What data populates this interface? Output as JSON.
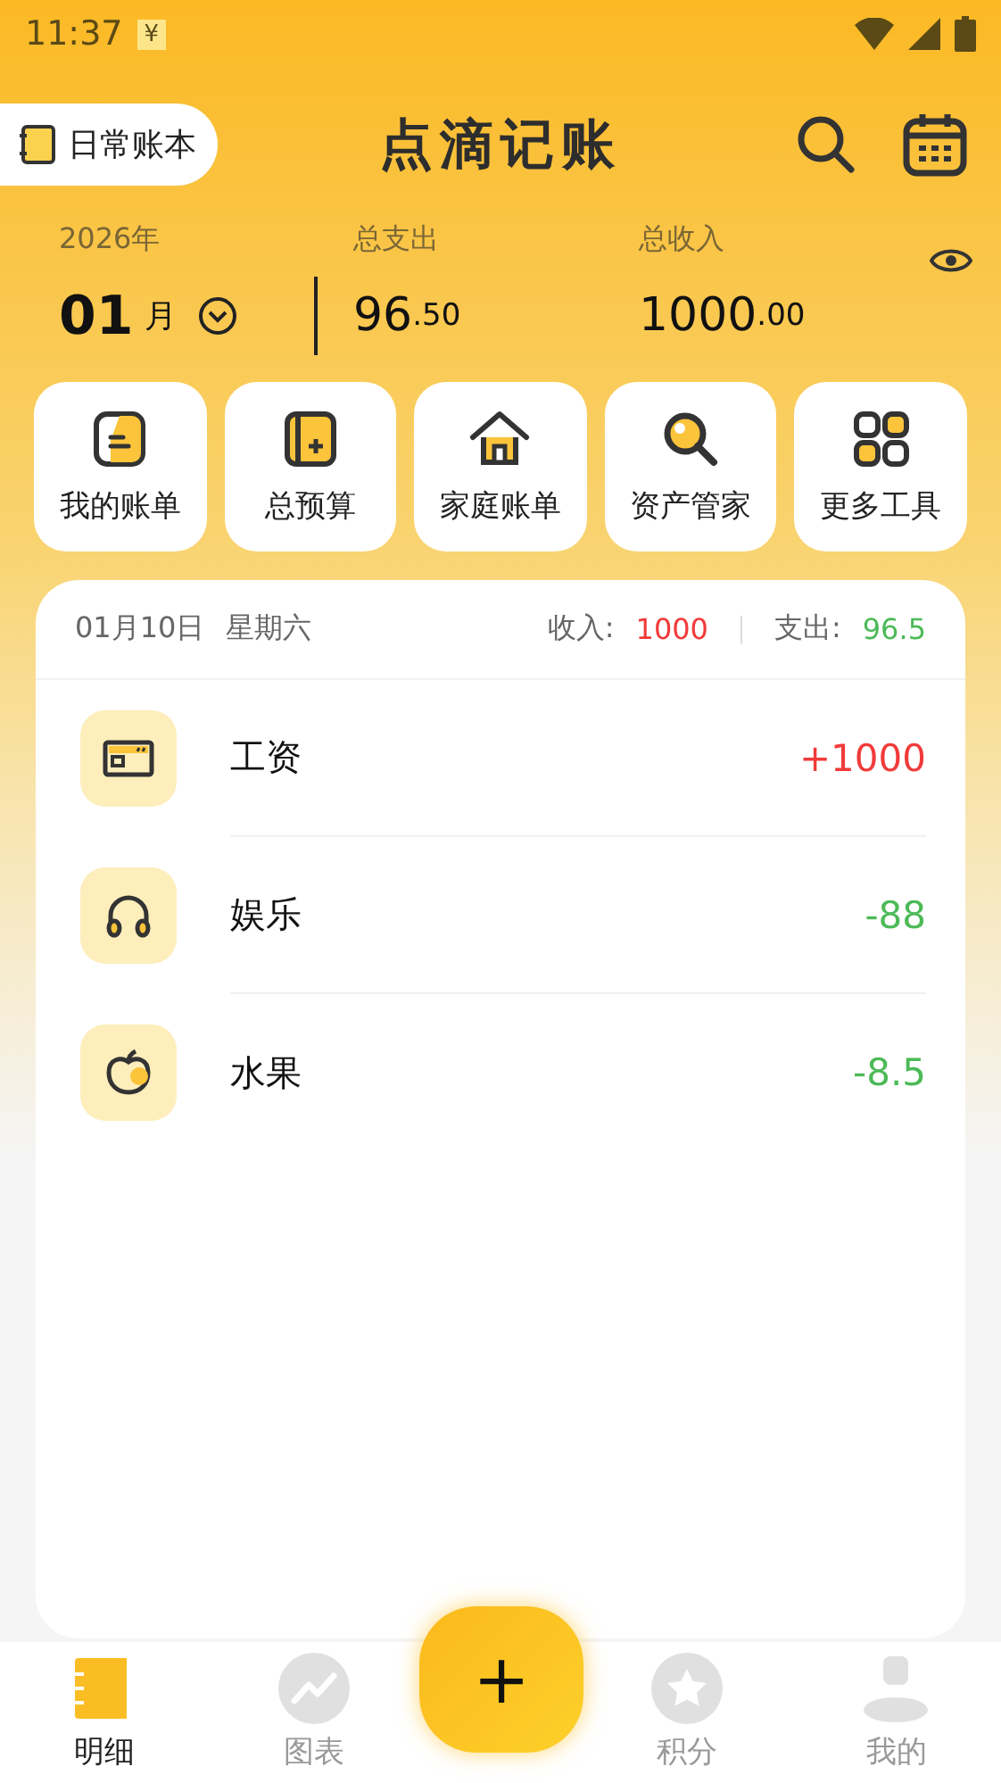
{
  "status_bar": {
    "time": "11:37",
    "notification": "¥"
  },
  "header": {
    "book": "日常账本",
    "title": "点滴记账"
  },
  "summary": {
    "year": "2026年",
    "month": "01",
    "month_unit": "月",
    "expense_label": "总支出",
    "expense_int": "96",
    "expense_dec": ".50",
    "income_label": "总收入",
    "income_int": "1000",
    "income_dec": ".00"
  },
  "tools": [
    {
      "label": "我的账单",
      "kind": "bill"
    },
    {
      "label": "总预算",
      "kind": "budget"
    },
    {
      "label": "家庭账单",
      "kind": "home"
    },
    {
      "label": "资产管家",
      "kind": "search"
    },
    {
      "label": "更多工具",
      "kind": "grid"
    }
  ],
  "day": {
    "date": "01月10日",
    "weekday": "星期六",
    "income_label": "收入:",
    "income": "1000",
    "expense_label": "支出:",
    "expense": "96.5"
  },
  "records": [
    {
      "name": "工资",
      "amount": "+1000",
      "color": "#f23a3a",
      "kind": "card"
    },
    {
      "name": "娱乐",
      "amount": "-88",
      "color": "#4cba57",
      "kind": "headphones"
    },
    {
      "name": "水果",
      "amount": "-8.5",
      "color": "#4cba57",
      "kind": "fruit"
    }
  ],
  "fab": "+",
  "tabs": [
    {
      "label": "明细",
      "kind": "book",
      "selected": true
    },
    {
      "label": "图表",
      "kind": "chart",
      "selected": false
    },
    {
      "label": "积分",
      "kind": "star",
      "selected": false
    },
    {
      "label": "我的",
      "kind": "user",
      "selected": false
    }
  ]
}
